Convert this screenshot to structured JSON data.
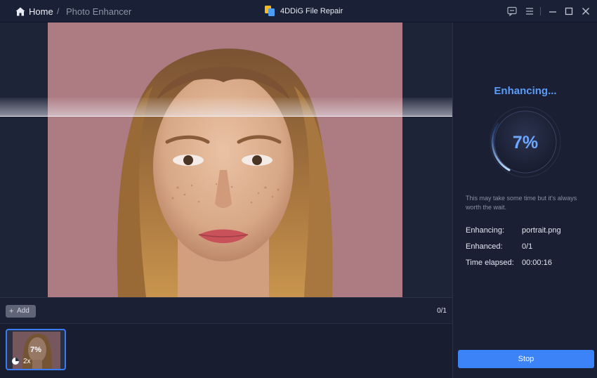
{
  "titlebar": {
    "home_label": "Home",
    "separator": "/",
    "breadcrumb_current": "Photo Enhancer",
    "app_title": "4DDiG File Repair"
  },
  "canvas": {
    "photo_subject": "portrait",
    "scan_progress": 0.07
  },
  "toolbar": {
    "add_label": "Add",
    "add_prefix": "+",
    "page_count": "0/1"
  },
  "thumbnails": [
    {
      "progress_label": "7%",
      "scale_label": "2x"
    }
  ],
  "panel": {
    "status_title": "Enhancing...",
    "progress_label": "7%",
    "progress_value": 7,
    "hint": "This may take some time but it's always worth the wait.",
    "info": [
      {
        "label": "Enhancing:",
        "value": "portrait.png"
      },
      {
        "label": "Enhanced:",
        "value": "0/1"
      },
      {
        "label": "Time elapsed:",
        "value": "00:00:16"
      }
    ],
    "stop_label": "Stop"
  },
  "colors": {
    "accent": "#3b83f6",
    "status_text": "#5b9cf8",
    "background": "#151a2e",
    "photo_background": "#ad7b82"
  },
  "icons": [
    "home-icon",
    "app-logo-icon",
    "feedback-icon",
    "menu-icon",
    "minimize-icon",
    "maximize-icon",
    "close-icon",
    "enhance-scale-icon"
  ]
}
